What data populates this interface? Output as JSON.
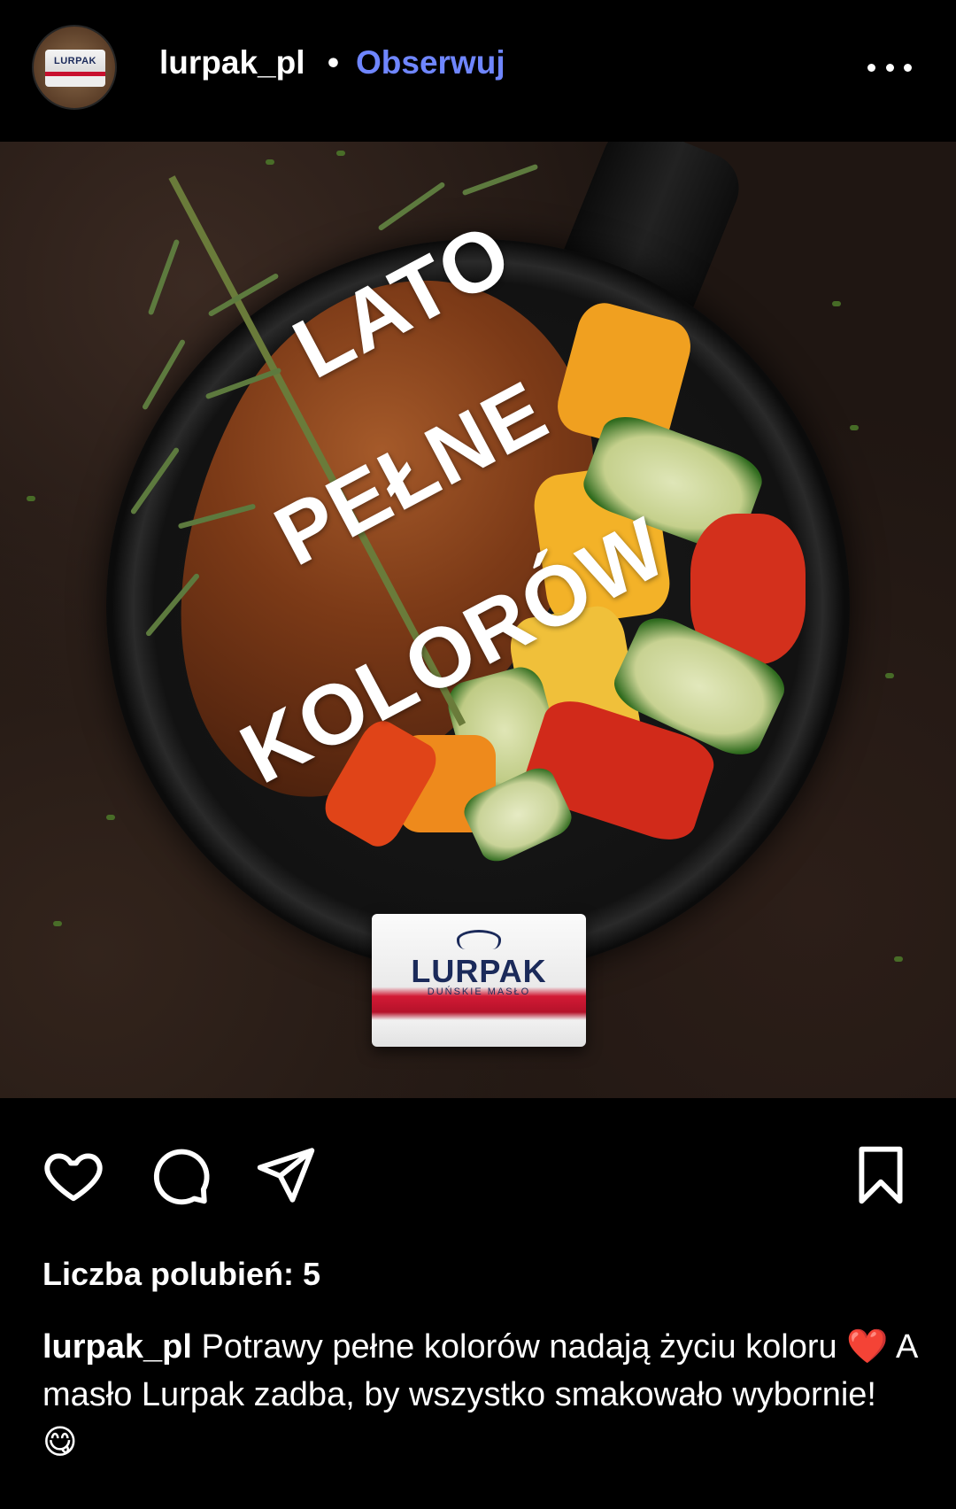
{
  "header": {
    "avatar_brand": "LURPAK",
    "username": "lurpak_pl",
    "separator": "•",
    "follow_label": "Obserwuj"
  },
  "post": {
    "overlay_lines": [
      "LATO",
      "PEŁNE",
      "KOLORÓW"
    ],
    "package_brand": "LURPAK",
    "package_subtitle": "DUŃSKIE MASŁO"
  },
  "actions": {
    "like_icon": "heart-icon",
    "comment_icon": "comment-icon",
    "share_icon": "send-icon",
    "save_icon": "bookmark-icon"
  },
  "likes_text": "Liczba polubień: 5",
  "caption": {
    "username": "lurpak_pl",
    "text": " Potrawy pełne kolorów nadają życiu koloru ❤️ A masło Lurpak zadba, by wszystko smakowało wybornie! 😋"
  },
  "colors": {
    "background": "#000000",
    "follow_accent": "#6f86ff",
    "text": "#ffffff"
  }
}
